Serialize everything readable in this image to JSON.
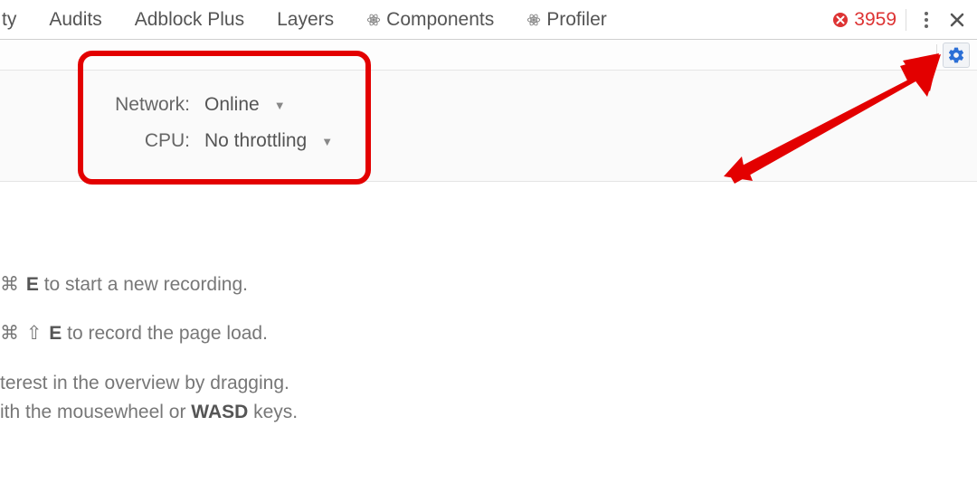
{
  "tabs": [
    {
      "label": "ty",
      "react": false
    },
    {
      "label": "Audits",
      "react": false
    },
    {
      "label": "Adblock Plus",
      "react": false
    },
    {
      "label": "Layers",
      "react": false
    },
    {
      "label": "Components",
      "react": true
    },
    {
      "label": "Profiler",
      "react": true
    }
  ],
  "errors": {
    "count": "3959"
  },
  "settings": {
    "network": {
      "label": "Network:",
      "value": "Online"
    },
    "cpu": {
      "label": "CPU:",
      "value": "No throttling"
    }
  },
  "instructions": {
    "line1_pre": "⌘ ",
    "line1_key": "E",
    "line1_post": " to start a new recording.",
    "line2_pre": "⌘ ⇧ ",
    "line2_key": "E",
    "line2_post": " to record the page load.",
    "line3": "terest in the overview by dragging.",
    "line4_pre": "ith the mousewheel or ",
    "line4_key": "WASD",
    "line4_post": " keys."
  }
}
